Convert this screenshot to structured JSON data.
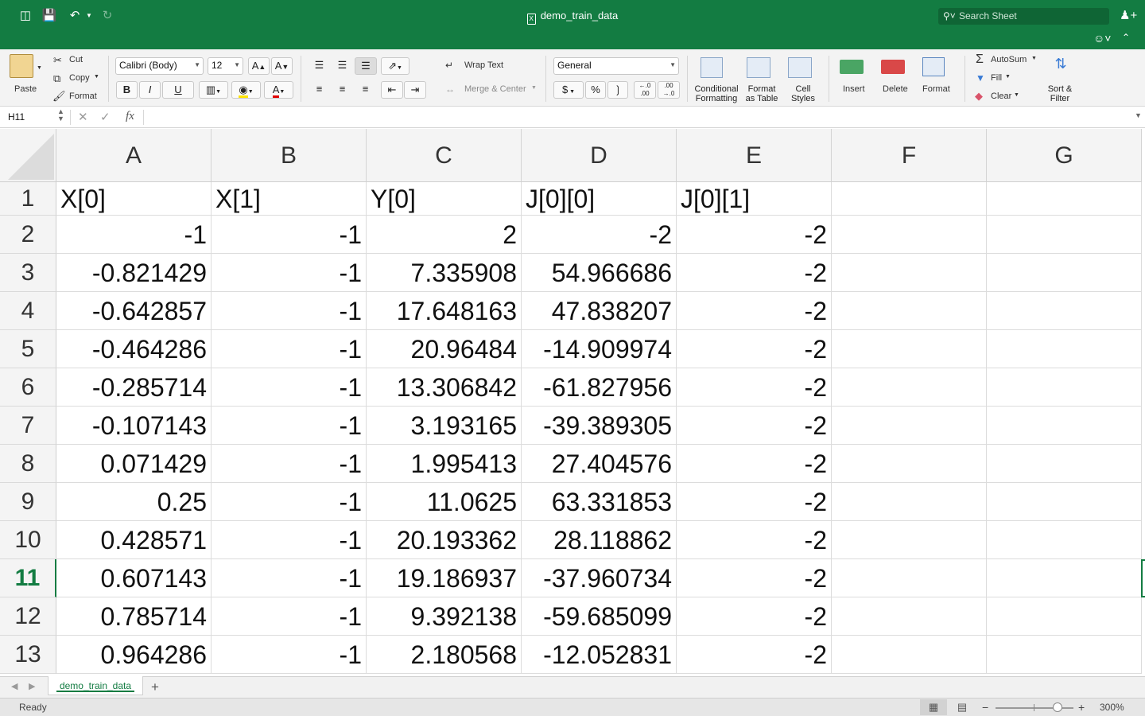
{
  "window": {
    "title": "demo_train_data",
    "search_placeholder": "Search Sheet"
  },
  "ribbon": {
    "paste": "Paste",
    "cut": "Cut",
    "copy": "Copy",
    "format_painter": "Format",
    "font_name": "Calibri (Body)",
    "font_size": "12",
    "bold": "B",
    "italic": "I",
    "underline": "U",
    "wrap_text": "Wrap Text",
    "merge_center": "Merge & Center",
    "number_format": "General",
    "currency": "$",
    "percent": "%",
    "conditional_formatting": [
      "Conditional",
      "Formatting"
    ],
    "format_as_table": [
      "Format",
      "as Table"
    ],
    "cell_styles": [
      "Cell",
      "Styles"
    ],
    "insert": "Insert",
    "delete": "Delete",
    "format": "Format",
    "autosum": "AutoSum",
    "fill": "Fill",
    "clear": "Clear",
    "sort_filter": [
      "Sort &",
      "Filter"
    ]
  },
  "formula_bar": {
    "name_box": "H11",
    "fx": "fx",
    "value": ""
  },
  "grid": {
    "columns": [
      "A",
      "B",
      "C",
      "D",
      "E",
      "F",
      "G"
    ],
    "header_row": [
      "X[0]",
      "X[1]",
      "Y[0]",
      "J[0][0]",
      "J[0][1]"
    ],
    "rows": [
      {
        "n": "1"
      },
      {
        "n": "2",
        "v": [
          "-1",
          "-1",
          "2",
          "-2",
          "-2"
        ]
      },
      {
        "n": "3",
        "v": [
          "-0.821429",
          "-1",
          "7.335908",
          "54.966686",
          "-2"
        ]
      },
      {
        "n": "4",
        "v": [
          "-0.642857",
          "-1",
          "17.648163",
          "47.838207",
          "-2"
        ]
      },
      {
        "n": "5",
        "v": [
          "-0.464286",
          "-1",
          "20.96484",
          "-14.909974",
          "-2"
        ]
      },
      {
        "n": "6",
        "v": [
          "-0.285714",
          "-1",
          "13.306842",
          "-61.827956",
          "-2"
        ]
      },
      {
        "n": "7",
        "v": [
          "-0.107143",
          "-1",
          "3.193165",
          "-39.389305",
          "-2"
        ]
      },
      {
        "n": "8",
        "v": [
          "0.071429",
          "-1",
          "1.995413",
          "27.404576",
          "-2"
        ]
      },
      {
        "n": "9",
        "v": [
          "0.25",
          "-1",
          "11.0625",
          "63.331853",
          "-2"
        ]
      },
      {
        "n": "10",
        "v": [
          "0.428571",
          "-1",
          "20.193362",
          "28.118862",
          "-2"
        ]
      },
      {
        "n": "11",
        "v": [
          "0.607143",
          "-1",
          "19.186937",
          "-37.960734",
          "-2"
        ]
      },
      {
        "n": "12",
        "v": [
          "0.785714",
          "-1",
          "9.392138",
          "-59.685099",
          "-2"
        ]
      },
      {
        "n": "13",
        "v": [
          "0.964286",
          "-1",
          "2.180568",
          "-12.052831",
          "-2"
        ]
      }
    ],
    "selected_row": "11"
  },
  "sheet_tabs": {
    "active": "demo_train_data",
    "add": "+"
  },
  "status_bar": {
    "status": "Ready",
    "zoom": "300%"
  },
  "colors": {
    "accent": "#137c42"
  }
}
